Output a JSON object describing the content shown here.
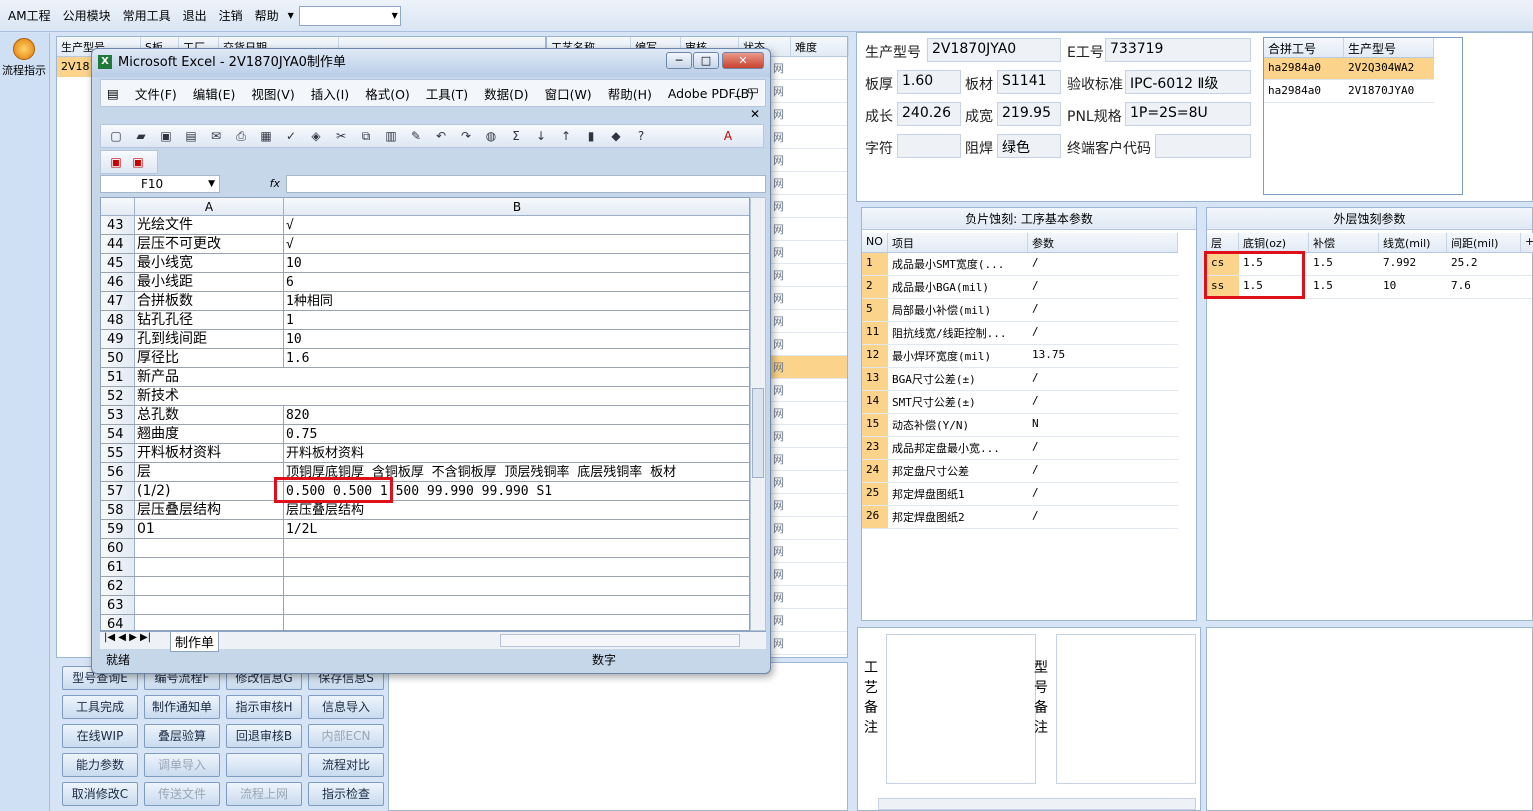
{
  "menubar": {
    "items": [
      "AM工程",
      "公用模块",
      "常用工具",
      "退出",
      "注销",
      "帮助"
    ],
    "combo_value": ""
  },
  "sidebar": {
    "flow_label": "流程指示"
  },
  "left_grid": {
    "headers": [
      "生产型号",
      "S板",
      "工厂",
      "交货日期"
    ],
    "first_cell": "2V18"
  },
  "process_grid": {
    "headers": [
      "工艺名称",
      "编写",
      "审核",
      "状态",
      "难度"
    ],
    "status_marks": [
      "网",
      "网",
      "网",
      "网",
      "网",
      "网",
      "网",
      "网",
      "网",
      "网",
      "网",
      "网",
      "网",
      "网",
      "网",
      "网",
      "网",
      "网",
      "网",
      "网",
      "网",
      "网",
      "网",
      "网",
      "网",
      "网"
    ]
  },
  "excel": {
    "title": "Microsoft Excel - 2V1870JYA0制作单",
    "menu": [
      "文件(F)",
      "编辑(E)",
      "视图(V)",
      "插入(I)",
      "格式(O)",
      "工具(T)",
      "数据(D)",
      "窗口(W)",
      "帮助(H)",
      "Adobe PDF(B)"
    ],
    "namebox": "F10",
    "fx": "fx",
    "col_a": "A",
    "col_b": "B",
    "rows": [
      {
        "n": "43",
        "a": "光绘文件",
        "b": "√"
      },
      {
        "n": "44",
        "a": "层压不可更改",
        "b": "√"
      },
      {
        "n": "45",
        "a": "最小线宽",
        "b": "10"
      },
      {
        "n": "46",
        "a": "最小线距",
        "b": "6"
      },
      {
        "n": "47",
        "a": "合拼板数",
        "b": "1种相同"
      },
      {
        "n": "48",
        "a": "钻孔孔径",
        "b": "1"
      },
      {
        "n": "49",
        "a": "孔到线间距",
        "b": "10"
      },
      {
        "n": "50",
        "a": "厚径比",
        "b": "1.6"
      },
      {
        "n": "51",
        "a": "新产品",
        "b": ""
      },
      {
        "n": "52",
        "a": "新技术",
        "b": ""
      },
      {
        "n": "53",
        "a": "总孔数",
        "b": "820"
      },
      {
        "n": "54",
        "a": "翘曲度",
        "b": "0.75"
      },
      {
        "n": "55",
        "a": "开料板材资料",
        "b": "开料板材资料"
      },
      {
        "n": "56",
        "a": "层",
        "b": "顶铜厚底铜厚 含铜板厚 不含铜板厚 顶层残铜率 底层残铜率 板材"
      },
      {
        "n": "57",
        "a": "(1/2)",
        "b": "0.500  0.500   1.500           99.990   99.990     S1"
      },
      {
        "n": "58",
        "a": "层压叠层结构",
        "b": "层压叠层结构"
      },
      {
        "n": "59",
        "a": "01",
        "b": "1/2L"
      },
      {
        "n": "60",
        "a": "",
        "b": ""
      },
      {
        "n": "61",
        "a": "",
        "b": ""
      },
      {
        "n": "62",
        "a": "",
        "b": ""
      },
      {
        "n": "63",
        "a": "",
        "b": ""
      },
      {
        "n": "64",
        "a": "",
        "b": ""
      }
    ],
    "sheet_tab": "制作单",
    "status_left": "就绪",
    "status_mid": "数字"
  },
  "bottom_buttons": [
    [
      "型号查询E",
      "编号流程F",
      "修改信息G",
      "保存信息S"
    ],
    [
      "工具完成",
      "制作通知单",
      "指示审核H",
      "信息导入"
    ],
    [
      "在线WIP",
      "叠层验算",
      "回退审核B",
      "内部ECN"
    ],
    [
      "能力参数",
      "调单导入",
      "",
      "流程对比"
    ],
    [
      "取消修改C",
      "传送文件",
      "流程上网",
      "指示检查"
    ]
  ],
  "info": {
    "model_lbl": "生产型号",
    "model_val": "2V1870JYA0",
    "eno_lbl": "E工号",
    "eno_val": "733719",
    "thick_lbl": "板厚",
    "thick_val": "1.60",
    "mat_lbl": "板材",
    "mat_val": "S1141",
    "std_lbl": "验收标准",
    "std_val": "IPC-6012 Ⅱ级",
    "len_lbl": "成长",
    "len_val": "240.26",
    "wid_lbl": "成宽",
    "wid_val": "219.95",
    "pnl_lbl": "PNL规格",
    "pnl_val": "1P=2S=8U",
    "char_lbl": "字符",
    "char_val": "",
    "mask_lbl": "阻焊",
    "mask_val": "绿色",
    "cust_lbl": "终端客户代码",
    "cust_val": ""
  },
  "merge_table": {
    "headers": [
      "合拼工号",
      "生产型号"
    ],
    "rows": [
      [
        "ha2984a0",
        "2V2Q304WA2"
      ],
      [
        "ha2984a0",
        "2V1870JYA0"
      ]
    ]
  },
  "etch_params": {
    "title": "负片蚀刻: 工序基本参数",
    "headers": [
      "NO",
      "项目",
      "参数"
    ],
    "rows": [
      [
        "1",
        "成品最小SMT宽度(...",
        "/"
      ],
      [
        "2",
        "成品最小BGA(mil)",
        "/"
      ],
      [
        "5",
        "局部最小补偿(mil)",
        "/"
      ],
      [
        "11",
        "阻抗线宽/线距控制...",
        "/"
      ],
      [
        "12",
        "最小焊环宽度(mil)",
        "13.75"
      ],
      [
        "13",
        "BGA尺寸公差(±)",
        "/"
      ],
      [
        "14",
        "SMT尺寸公差(±)",
        "/"
      ],
      [
        "15",
        "动态补偿(Y/N)",
        "N"
      ],
      [
        "23",
        "成品邦定盘最小宽...",
        "/"
      ],
      [
        "24",
        "邦定盘尺寸公差",
        "/"
      ],
      [
        "25",
        "邦定焊盘图纸1",
        "/"
      ],
      [
        "26",
        "邦定焊盘图纸2",
        "/"
      ]
    ]
  },
  "outer_etch": {
    "title": "外层蚀刻参数",
    "headers": [
      "层",
      "底铜(oz)",
      "补偿",
      "线宽(mil)",
      "间距(mil)",
      "+"
    ],
    "rows": [
      [
        "cs",
        "1.5",
        "1.5",
        "7.992",
        "25.2"
      ],
      [
        "ss",
        "1.5",
        "1.5",
        "10",
        "7.6"
      ]
    ]
  },
  "remarks": {
    "process_lbl": "工艺备注",
    "model_lbl": "型号备注"
  },
  "colors": {
    "highlight": "#fbd38a",
    "red_box": "#e0101a",
    "header_bg": "#dfe8f3"
  }
}
